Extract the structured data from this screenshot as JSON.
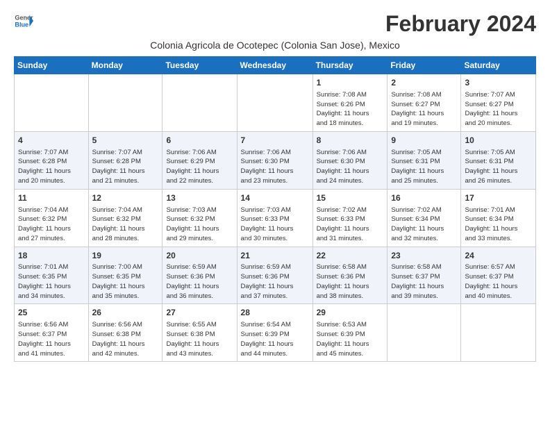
{
  "logo": {
    "line1": "General",
    "line2": "Blue"
  },
  "title": "February 2024",
  "location": "Colonia Agricola de Ocotepec (Colonia San Jose), Mexico",
  "days_of_week": [
    "Sunday",
    "Monday",
    "Tuesday",
    "Wednesday",
    "Thursday",
    "Friday",
    "Saturday"
  ],
  "weeks": [
    [
      {
        "day": "",
        "info": ""
      },
      {
        "day": "",
        "info": ""
      },
      {
        "day": "",
        "info": ""
      },
      {
        "day": "",
        "info": ""
      },
      {
        "day": "1",
        "info": "Sunrise: 7:08 AM\nSunset: 6:26 PM\nDaylight: 11 hours\nand 18 minutes."
      },
      {
        "day": "2",
        "info": "Sunrise: 7:08 AM\nSunset: 6:27 PM\nDaylight: 11 hours\nand 19 minutes."
      },
      {
        "day": "3",
        "info": "Sunrise: 7:07 AM\nSunset: 6:27 PM\nDaylight: 11 hours\nand 20 minutes."
      }
    ],
    [
      {
        "day": "4",
        "info": "Sunrise: 7:07 AM\nSunset: 6:28 PM\nDaylight: 11 hours\nand 20 minutes."
      },
      {
        "day": "5",
        "info": "Sunrise: 7:07 AM\nSunset: 6:28 PM\nDaylight: 11 hours\nand 21 minutes."
      },
      {
        "day": "6",
        "info": "Sunrise: 7:06 AM\nSunset: 6:29 PM\nDaylight: 11 hours\nand 22 minutes."
      },
      {
        "day": "7",
        "info": "Sunrise: 7:06 AM\nSunset: 6:30 PM\nDaylight: 11 hours\nand 23 minutes."
      },
      {
        "day": "8",
        "info": "Sunrise: 7:06 AM\nSunset: 6:30 PM\nDaylight: 11 hours\nand 24 minutes."
      },
      {
        "day": "9",
        "info": "Sunrise: 7:05 AM\nSunset: 6:31 PM\nDaylight: 11 hours\nand 25 minutes."
      },
      {
        "day": "10",
        "info": "Sunrise: 7:05 AM\nSunset: 6:31 PM\nDaylight: 11 hours\nand 26 minutes."
      }
    ],
    [
      {
        "day": "11",
        "info": "Sunrise: 7:04 AM\nSunset: 6:32 PM\nDaylight: 11 hours\nand 27 minutes."
      },
      {
        "day": "12",
        "info": "Sunrise: 7:04 AM\nSunset: 6:32 PM\nDaylight: 11 hours\nand 28 minutes."
      },
      {
        "day": "13",
        "info": "Sunrise: 7:03 AM\nSunset: 6:32 PM\nDaylight: 11 hours\nand 29 minutes."
      },
      {
        "day": "14",
        "info": "Sunrise: 7:03 AM\nSunset: 6:33 PM\nDaylight: 11 hours\nand 30 minutes."
      },
      {
        "day": "15",
        "info": "Sunrise: 7:02 AM\nSunset: 6:33 PM\nDaylight: 11 hours\nand 31 minutes."
      },
      {
        "day": "16",
        "info": "Sunrise: 7:02 AM\nSunset: 6:34 PM\nDaylight: 11 hours\nand 32 minutes."
      },
      {
        "day": "17",
        "info": "Sunrise: 7:01 AM\nSunset: 6:34 PM\nDaylight: 11 hours\nand 33 minutes."
      }
    ],
    [
      {
        "day": "18",
        "info": "Sunrise: 7:01 AM\nSunset: 6:35 PM\nDaylight: 11 hours\nand 34 minutes."
      },
      {
        "day": "19",
        "info": "Sunrise: 7:00 AM\nSunset: 6:35 PM\nDaylight: 11 hours\nand 35 minutes."
      },
      {
        "day": "20",
        "info": "Sunrise: 6:59 AM\nSunset: 6:36 PM\nDaylight: 11 hours\nand 36 minutes."
      },
      {
        "day": "21",
        "info": "Sunrise: 6:59 AM\nSunset: 6:36 PM\nDaylight: 11 hours\nand 37 minutes."
      },
      {
        "day": "22",
        "info": "Sunrise: 6:58 AM\nSunset: 6:36 PM\nDaylight: 11 hours\nand 38 minutes."
      },
      {
        "day": "23",
        "info": "Sunrise: 6:58 AM\nSunset: 6:37 PM\nDaylight: 11 hours\nand 39 minutes."
      },
      {
        "day": "24",
        "info": "Sunrise: 6:57 AM\nSunset: 6:37 PM\nDaylight: 11 hours\nand 40 minutes."
      }
    ],
    [
      {
        "day": "25",
        "info": "Sunrise: 6:56 AM\nSunset: 6:37 PM\nDaylight: 11 hours\nand 41 minutes."
      },
      {
        "day": "26",
        "info": "Sunrise: 6:56 AM\nSunset: 6:38 PM\nDaylight: 11 hours\nand 42 minutes."
      },
      {
        "day": "27",
        "info": "Sunrise: 6:55 AM\nSunset: 6:38 PM\nDaylight: 11 hours\nand 43 minutes."
      },
      {
        "day": "28",
        "info": "Sunrise: 6:54 AM\nSunset: 6:39 PM\nDaylight: 11 hours\nand 44 minutes."
      },
      {
        "day": "29",
        "info": "Sunrise: 6:53 AM\nSunset: 6:39 PM\nDaylight: 11 hours\nand 45 minutes."
      },
      {
        "day": "",
        "info": ""
      },
      {
        "day": "",
        "info": ""
      }
    ]
  ]
}
